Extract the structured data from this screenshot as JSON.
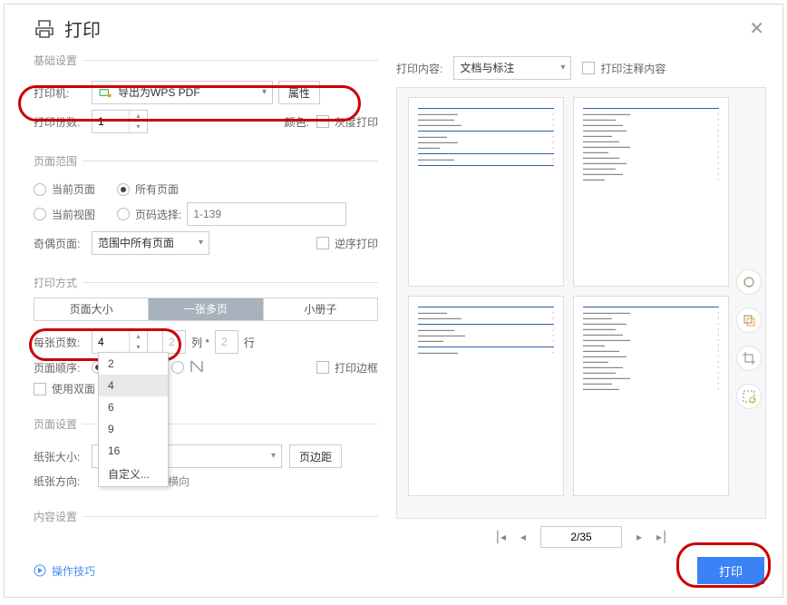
{
  "title": "打印",
  "basic": {
    "legend": "基础设置",
    "printer_label": "打印机:",
    "printer_value": "导出为WPS PDF",
    "properties_btn": "属性",
    "copies_label": "打印份数:",
    "copies_value": "1",
    "color_label": "颜色:",
    "grayscale_label": "灰度打印"
  },
  "range": {
    "legend": "页面范围",
    "current_page": "当前页面",
    "all_pages": "所有页面",
    "current_view": "当前视图",
    "page_select_label": "页码选择:",
    "page_select_placeholder": "1-139",
    "oddeven_label": "奇偶页面:",
    "oddeven_value": "范围中所有页面",
    "reverse_label": "逆序打印"
  },
  "mode": {
    "legend": "打印方式",
    "tab_size": "页面大小",
    "tab_multi": "一张多页",
    "tab_booklet": "小册子",
    "perpage_label": "每张页数:",
    "perpage_value": "4",
    "cols_value": "2",
    "separator": "列 *",
    "rows_value": "2",
    "rows_unit": "行",
    "order_label": "页面顺序:",
    "border_label": "打印边框",
    "duplex_label": "使用双面",
    "dropdown": {
      "o0": "2",
      "o1": "4",
      "o2": "6",
      "o3": "9",
      "o4": "16",
      "o5": "自定义..."
    }
  },
  "page": {
    "legend": "页面设置",
    "size_label": "纸张大小:",
    "margin_btn": "页边距",
    "orient_label": "纸张方向:",
    "landscape": "横向"
  },
  "content_legend": "内容设置",
  "right": {
    "content_label": "打印内容:",
    "content_value": "文档与标注",
    "annot_label": "打印注释内容",
    "pager_text": "2/35"
  },
  "footer": {
    "tips": "操作技巧",
    "print_btn": "打印"
  }
}
